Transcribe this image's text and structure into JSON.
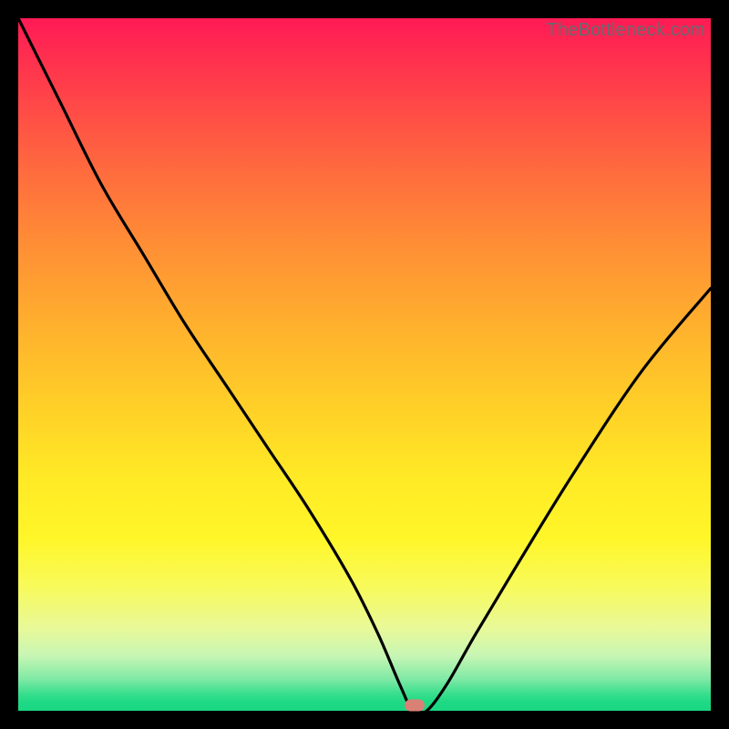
{
  "watermark": "TheBottleneck.com",
  "colors": {
    "frame": "#000000",
    "curve": "#000000",
    "marker": "#da8176",
    "gradient_top": "#ff1a55",
    "gradient_bottom": "#1ad783"
  },
  "marker": {
    "x_pct": 57.2,
    "y_pct": 99.2
  },
  "chart_data": {
    "type": "line",
    "title": "",
    "subtitle": "",
    "xlabel": "",
    "ylabel": "",
    "xlim": [
      0,
      100
    ],
    "ylim": [
      0,
      100
    ],
    "annotations": [
      "TheBottleneck.com"
    ],
    "series": [
      {
        "name": "bottleneck-curve",
        "x": [
          0,
          6,
          12,
          18,
          24,
          30,
          36,
          42,
          48,
          52,
          55,
          57,
          59,
          62,
          66,
          72,
          80,
          90,
          100
        ],
        "y": [
          100,
          88,
          76,
          66,
          56,
          47,
          38,
          29,
          19,
          11,
          4,
          0,
          0,
          4,
          11,
          21,
          34,
          49,
          61
        ]
      }
    ],
    "marker_point": {
      "x": 57.2,
      "y": 0.8
    },
    "background_gradient_stops": [
      {
        "pct": 0,
        "color": "#ff1a55"
      },
      {
        "pct": 10,
        "color": "#ff3f4a"
      },
      {
        "pct": 22,
        "color": "#ff6b3e"
      },
      {
        "pct": 33,
        "color": "#ff8f35"
      },
      {
        "pct": 45,
        "color": "#ffb22d"
      },
      {
        "pct": 57,
        "color": "#ffd227"
      },
      {
        "pct": 66,
        "color": "#ffe926"
      },
      {
        "pct": 75,
        "color": "#fff628"
      },
      {
        "pct": 82,
        "color": "#f8fa5a"
      },
      {
        "pct": 88,
        "color": "#e9f998"
      },
      {
        "pct": 92,
        "color": "#c8f6b4"
      },
      {
        "pct": 95.5,
        "color": "#7de9a4"
      },
      {
        "pct": 97.5,
        "color": "#3adf8e"
      },
      {
        "pct": 98.7,
        "color": "#1fd984"
      },
      {
        "pct": 100,
        "color": "#1ad783"
      }
    ]
  }
}
